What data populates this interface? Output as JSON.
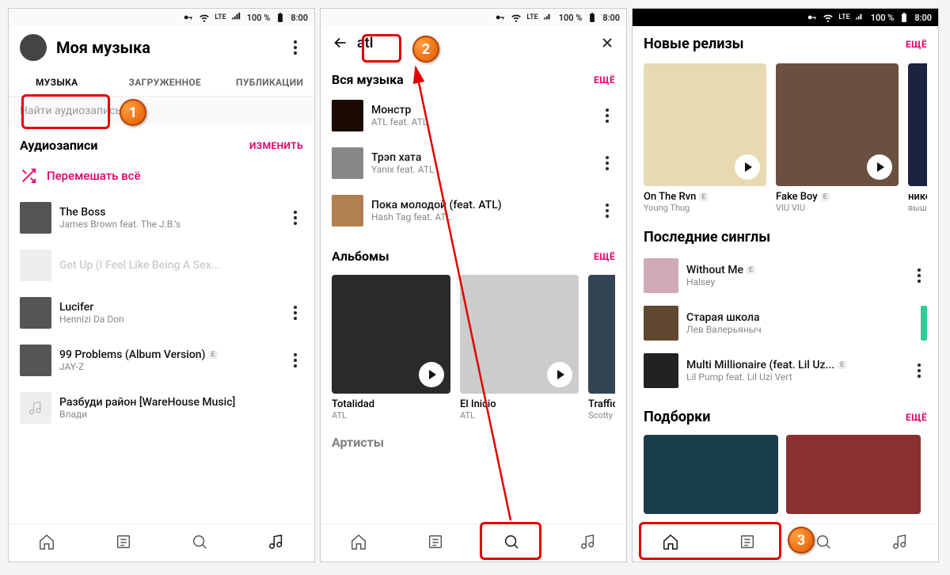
{
  "status": {
    "battery": "100 %",
    "time": "8:00",
    "lte": "LTE"
  },
  "screen1": {
    "title": "Моя музыка",
    "tabs": [
      "МУЗЫКА",
      "ЗАГРУЖЕННОЕ",
      "ПУБЛИКАЦИИ"
    ],
    "search_placeholder": "Найти аудиозапись",
    "section_audio": "Аудиозаписи",
    "edit": "ИЗМЕНИТЬ",
    "shuffle": "Перемешать всё",
    "tracks": [
      {
        "title": "The Boss",
        "artist": "James Brown feat. The J.B.'s"
      },
      {
        "title": "Get Up (I Feel Like Being A Sex...",
        "artist": "",
        "faded": true
      },
      {
        "title": "Lucifer",
        "artist": "Hennizi Da Don"
      },
      {
        "title": "99 Problems (Album Version)",
        "artist": "JAY-Z",
        "explicit": true
      },
      {
        "title": "Разбуди район [WareHouse Music]",
        "artist": "Влади",
        "placeholder": true
      }
    ]
  },
  "screen2": {
    "query": "atl",
    "section_all": "Вся музыка",
    "more": "ЕЩЁ",
    "tracks": [
      {
        "title": "Монстр",
        "artist": "ATL feat. ATL"
      },
      {
        "title": "Трэп хата",
        "artist": "Yanix feat. ATL"
      },
      {
        "title": "Пока молодой (feat. ATL)",
        "artist": "Hash Tag feat. ATL"
      }
    ],
    "section_albums": "Альбомы",
    "albums": [
      {
        "title": "Totalidad",
        "artist": "ATL"
      },
      {
        "title": "El Inicio",
        "artist": "ATL"
      },
      {
        "title": "Traffic Ja...",
        "artist": "Scotty ATL"
      }
    ],
    "section_artists": "Артисты"
  },
  "screen3": {
    "section_releases": "Новые релизы",
    "more": "ЕЩЁ",
    "releases": [
      {
        "title": "On The Rvn",
        "artist": "Young Thug",
        "explicit": true
      },
      {
        "title": "Fake Boy",
        "artist": "VIU VIU",
        "explicit": true
      },
      {
        "title": "никогда...",
        "artist": "вышел по..."
      }
    ],
    "section_singles": "Последние синглы",
    "singles": [
      {
        "title": "Without Me",
        "artist": "Halsey",
        "explicit": true
      },
      {
        "title": "Старая школа",
        "artist": "Лев Валерьяныч"
      },
      {
        "title": "Multi Millionaire (feat. Lil Uz...",
        "artist": "Lil Pump feat. Lil Uzi Vert",
        "explicit": true
      }
    ],
    "section_compilations": "Подборки"
  },
  "callouts": {
    "c1": "1",
    "c2": "2",
    "c3": "3"
  }
}
